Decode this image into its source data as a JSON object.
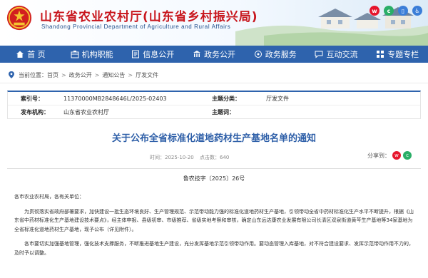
{
  "header": {
    "title": "山东省农业农村厅(山东省乡村振兴局)",
    "subtitle": "Shandong Provincial Department of Agriculture and Rural Affairs",
    "emblem_icon": "national-emblem-icon",
    "social_icons": [
      "weibo-icon",
      "wechat-icon",
      "mobile-icon",
      "accessibility-icon"
    ]
  },
  "nav": {
    "items": [
      {
        "label": "首 页",
        "icon": "home-icon"
      },
      {
        "label": "机构职能",
        "icon": "institution-icon"
      },
      {
        "label": "信息公开",
        "icon": "info-icon"
      },
      {
        "label": "政务公开",
        "icon": "government-icon"
      },
      {
        "label": "政务服务",
        "icon": "service-icon"
      },
      {
        "label": "互动交流",
        "icon": "interaction-icon"
      },
      {
        "label": "专题专栏",
        "icon": "topic-icon"
      }
    ]
  },
  "breadcrumb": {
    "prefix": "当前位置：",
    "items": [
      "首页",
      "政务公开",
      "通知公告",
      "厅发文件"
    ],
    "separator": ">"
  },
  "meta": {
    "index_label": "索引号：",
    "index_value": "11370000MB2848646L/2025-02403",
    "category_label": "主题分类：",
    "category_value": "厅发文件",
    "publisher_label": "发布机构：",
    "publisher_value": "山东省农业农村厅",
    "topic_label": "主题词：",
    "topic_value": ""
  },
  "document": {
    "title": "关于公布全省标准化道地药材生产基地名单的通知",
    "date": "时间：2025-10-20",
    "views": "点击数：640",
    "share_label": "分享到：",
    "doc_number": "鲁农技字〔2025〕26号",
    "salutation": "各市农业农村局，各有关单位：",
    "paragraph1": "为贯彻落实省政府部署要求，加快建设一批生态环境良好、生产管理规范、示范带动能力强的标准化道地药材生产基地，引领带动全省中药材标准化生产水平不断提升，根据《山东省中药材标准化生产基地建设技术要点》，经主体申报、县级初审、市级推荐、省级实地考察和审核，确定山东远达康农业发展有限公司长清区双泉街道黄芩生产基地等34家基地为全省标准化道地药材生产基地，现予公布（详见附件）。",
    "paragraph2": "各市要切实加强基地管理，强化技术支撑服务，不断推进基地生产建设，充分发挥基地示范引领带动作用。要动态管理入库基地，对不符合建设要求、发挥示范带动作用不力的，及时予以调整。"
  },
  "colors": {
    "brand_red": "#c8161d",
    "nav_blue": "#2e63ad",
    "title_blue": "#2e5fa8"
  }
}
